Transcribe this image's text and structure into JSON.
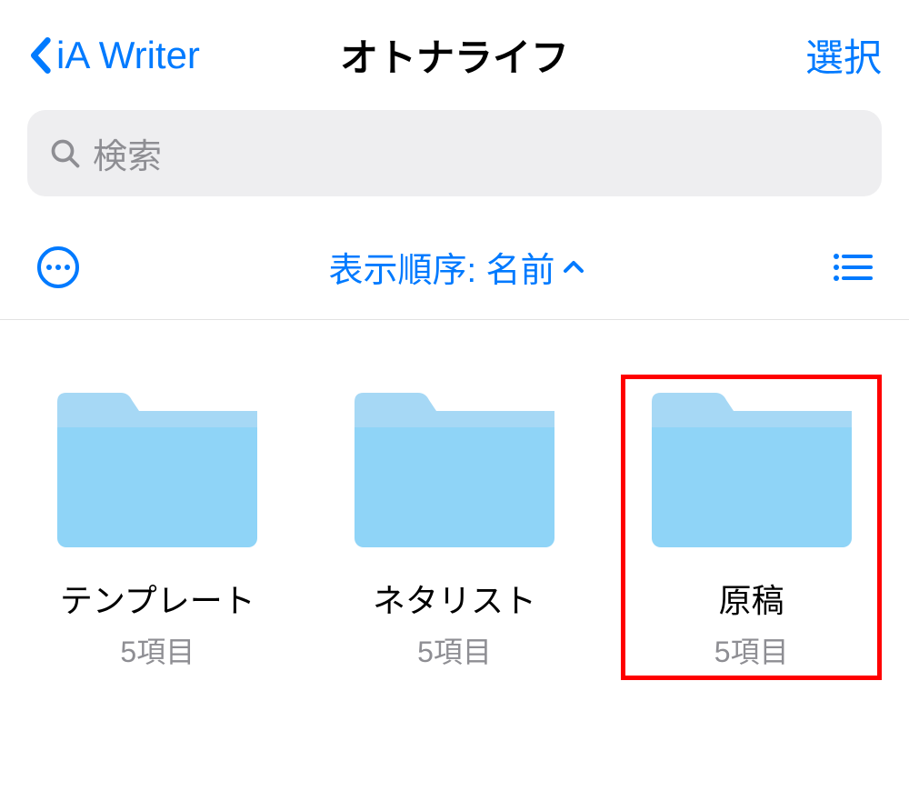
{
  "nav": {
    "back_label": "iA Writer",
    "title": "オトナライフ",
    "select_label": "選択"
  },
  "search": {
    "placeholder": "検索"
  },
  "sort": {
    "label": "表示順序: 名前"
  },
  "folders": [
    {
      "name": "テンプレート",
      "count": "5項目",
      "highlighted": false
    },
    {
      "name": "ネタリスト",
      "count": "5項目",
      "highlighted": false
    },
    {
      "name": "原稿",
      "count": "5項目",
      "highlighted": true
    }
  ],
  "colors": {
    "accent": "#007aff",
    "folder_light": "#a6d8f5",
    "folder_main": "#8fd4f7",
    "highlight": "#ff0000"
  }
}
